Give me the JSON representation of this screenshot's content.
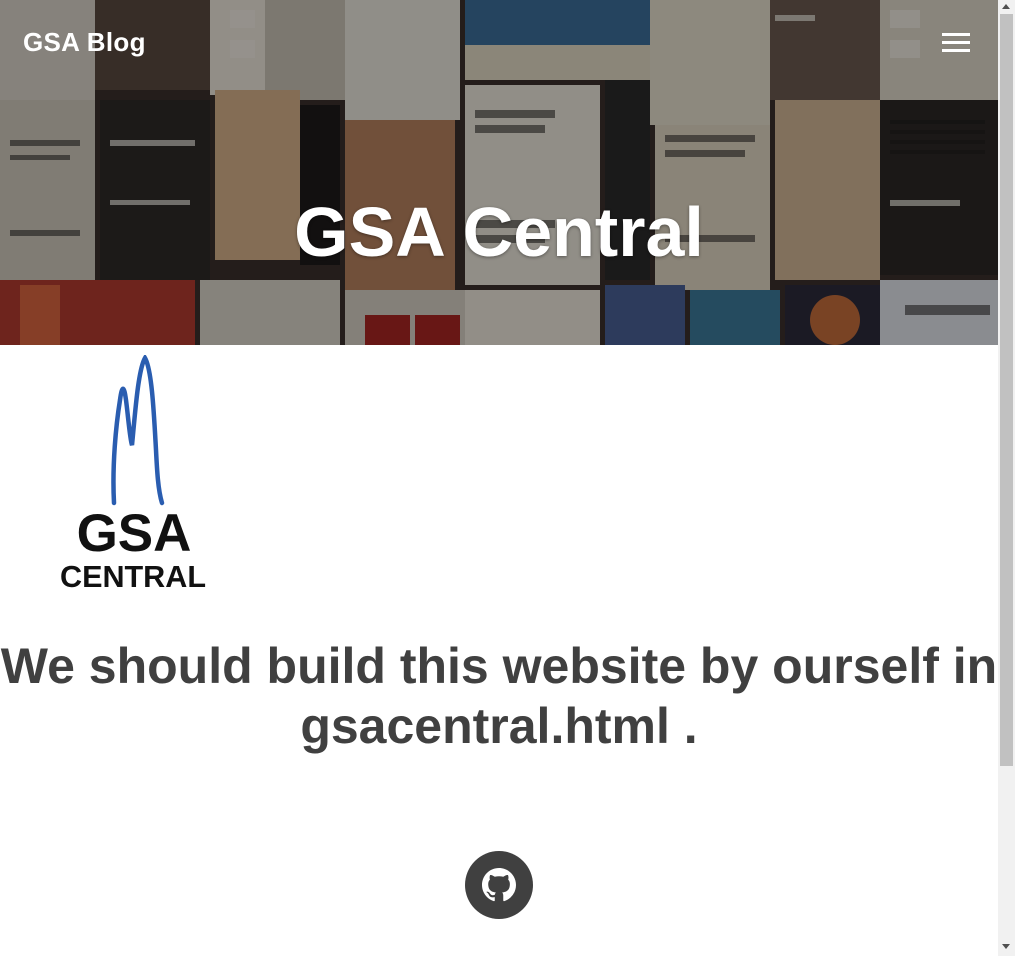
{
  "navbar": {
    "brand": "GSA Blog",
    "menu_icon": "hamburger-menu-icon"
  },
  "hero": {
    "title": "GSA Central",
    "background": "concert-posters-collage"
  },
  "logo": {
    "line1": "GSA",
    "line2": "CENTRAL",
    "accent_color": "#2a5db0"
  },
  "main": {
    "heading": "We should build this website by ourself in gsacentral.html ."
  },
  "footer": {
    "github_icon": "github-icon"
  },
  "colors": {
    "text_dark": "#404040",
    "white": "#ffffff"
  }
}
